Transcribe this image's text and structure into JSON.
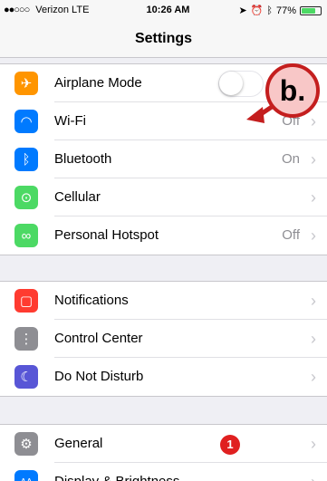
{
  "status_bar": {
    "signal_dots": "●●○○○",
    "carrier": "Verizon  LTE",
    "time": "10:26 AM",
    "battery_text": "77%",
    "battery_level": 0.77
  },
  "nav": {
    "title": "Settings"
  },
  "groups": [
    {
      "rows": [
        {
          "label": "Airplane Mode",
          "icon": "airplane-icon",
          "color": "#ff9500",
          "glyph": "✈",
          "toggle": false
        },
        {
          "label": "Wi-Fi",
          "icon": "wifi-icon",
          "color": "#007aff",
          "glyph": "◠",
          "detail": "Off"
        },
        {
          "label": "Bluetooth",
          "icon": "bluetooth-icon",
          "color": "#007aff",
          "glyph": "ᛒ",
          "detail": "On"
        },
        {
          "label": "Cellular",
          "icon": "cellular-icon",
          "color": "#4cd964",
          "glyph": "⊙",
          "detail": ""
        },
        {
          "label": "Personal Hotspot",
          "icon": "hotspot-icon",
          "color": "#4cd964",
          "glyph": "∞",
          "detail": "Off"
        }
      ]
    },
    {
      "rows": [
        {
          "label": "Notifications",
          "icon": "notifications-icon",
          "color": "#ff3b30",
          "glyph": "▢"
        },
        {
          "label": "Control Center",
          "icon": "control-center-icon",
          "color": "#8e8e93",
          "glyph": "⋮"
        },
        {
          "label": "Do Not Disturb",
          "icon": "moon-icon",
          "color": "#5856d6",
          "glyph": "☾"
        }
      ]
    },
    {
      "rows": [
        {
          "label": "General",
          "icon": "gear-icon",
          "color": "#8e8e93",
          "glyph": "⚙",
          "badge": "1"
        },
        {
          "label": "Display & Brightness",
          "icon": "display-icon",
          "color": "#007aff",
          "glyph": "AA"
        }
      ]
    }
  ],
  "annotation": {
    "label": "b.",
    "color": "#c41e1e"
  },
  "chevron": "›"
}
